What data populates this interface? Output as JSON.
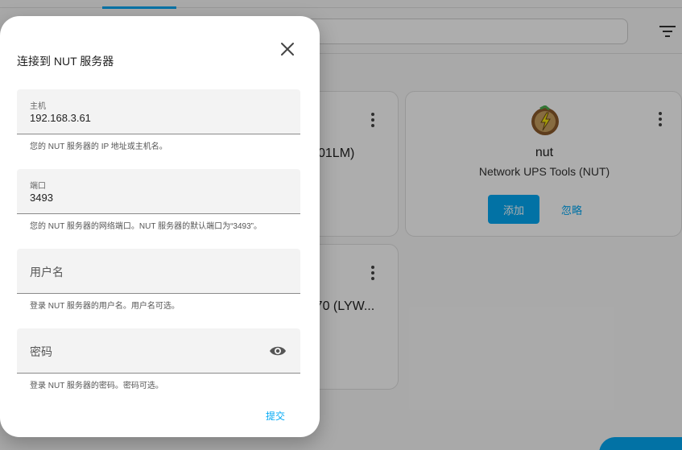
{
  "background": {
    "card_partial_1": "01LM)",
    "card_partial_2": "A70 (LYW...",
    "nut_card": {
      "name": "nut",
      "subtitle": "Network UPS Tools (NUT)",
      "add_label": "添加",
      "ignore_label": "忽略"
    }
  },
  "dialog": {
    "title": "连接到 NUT 服务器",
    "host": {
      "label": "主机",
      "value": "192.168.3.61",
      "helper": "您的 NUT 服务器的 IP 地址或主机名。"
    },
    "port": {
      "label": "端口",
      "value": "3493",
      "helper": "您的 NUT 服务器的网络端口。NUT 服务器的默认端口为“3493”。"
    },
    "username": {
      "label": "用户名",
      "helper": "登录 NUT 服务器的用户名。用户名可选。"
    },
    "password": {
      "label": "密码",
      "helper": "登录 NUT 服务器的密码。密码可选。"
    },
    "submit_label": "提交"
  },
  "colors": {
    "accent": "#03a9f4",
    "field_bg": "#f3f3f3"
  }
}
